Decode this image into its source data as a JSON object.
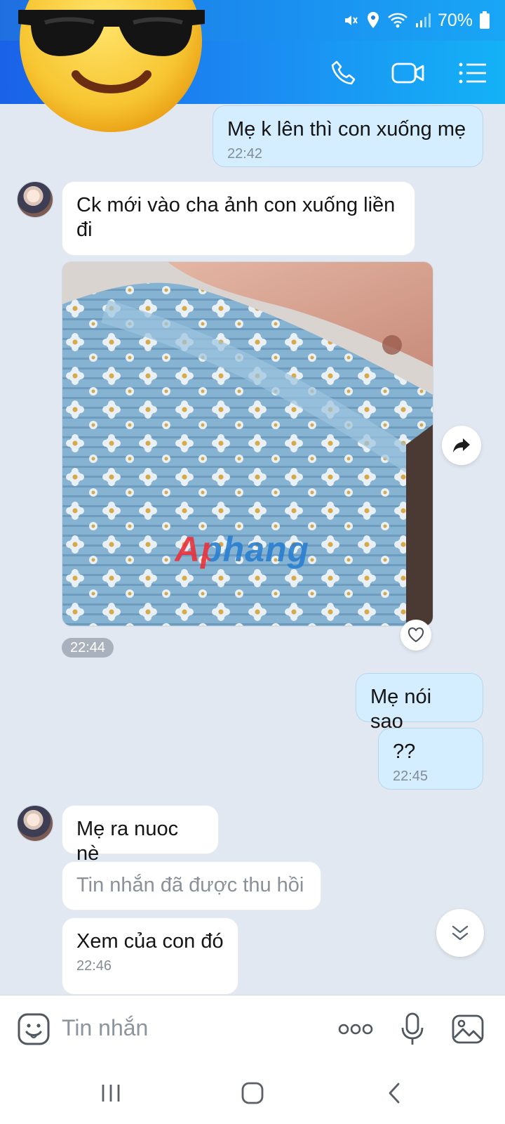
{
  "status_bar": {
    "battery_percent": "70%",
    "icons": [
      "mute-vibrate-icon",
      "location-icon",
      "wifi-icon",
      "signal-icon",
      "battery-icon"
    ]
  },
  "header": {
    "actions": [
      "phone-call-icon",
      "video-call-icon",
      "menu-list-icon"
    ]
  },
  "messages": [
    {
      "direction": "outgoing",
      "text": "Mẹ k lên thì con xuống mẹ",
      "time": "22:42"
    },
    {
      "direction": "incoming",
      "text": "Ck mới vào cha ảnh con xuống liền đi"
    },
    {
      "direction": "incoming",
      "type": "photo",
      "watermark": "Aphang",
      "time": "22:44"
    },
    {
      "direction": "outgoing",
      "text": "Mẹ nói sao"
    },
    {
      "direction": "outgoing",
      "text": "??",
      "time": "22:45"
    },
    {
      "direction": "incoming",
      "text": "Mẹ ra nuoc nè"
    },
    {
      "direction": "incoming",
      "text": "Tin nhắn đã được thu hồi",
      "recalled": true
    },
    {
      "direction": "incoming",
      "text": "Xem của con đó",
      "time": "22:46"
    }
  ],
  "composer": {
    "placeholder": "Tin nhắn",
    "icons": [
      "sticker-emoji-icon",
      "more-dots-icon",
      "microphone-icon",
      "image-icon"
    ]
  },
  "nav": {
    "icons": [
      "recent-apps-icon",
      "home-icon",
      "back-icon"
    ]
  },
  "colors": {
    "header_gradient_start": "#1a62e8",
    "header_gradient_end": "#14b2f6",
    "chat_background": "#e2e8f1",
    "outgoing_bubble": "#d4eeff",
    "incoming_bubble": "#ffffff"
  }
}
